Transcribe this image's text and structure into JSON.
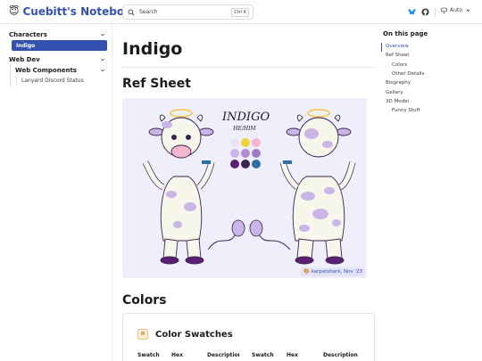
{
  "header": {
    "logo_emoji": "😇",
    "site_title": "Cuebitt's Notebook",
    "search_placeholder": "Search",
    "search_shortcut": "Ctrl K",
    "theme_label": "Auto"
  },
  "sidebar": {
    "groups": [
      {
        "label": "Characters",
        "items": [
          {
            "label": "Indigo",
            "active": true
          }
        ]
      },
      {
        "label": "Web Dev",
        "subgroups": [
          {
            "label": "Web Components",
            "items": [
              {
                "label": "Lanyard Discord Status"
              }
            ]
          }
        ]
      }
    ]
  },
  "page": {
    "title": "Indigo",
    "sections": {
      "ref_sheet": "Ref Sheet",
      "colors": "Colors"
    },
    "image": {
      "name_text": "INDIGO",
      "pronouns_text": "HE/HIM",
      "credit": "karpetshark, Nov '23",
      "palette": [
        "#e7e3f4",
        "#f4d23a",
        "#f3b6cf",
        "#c9b5e6",
        "#b48ad6",
        "#9b7cc5",
        "#5b1f73",
        "#3b2350",
        "#2f6fa6"
      ]
    },
    "swatch_card": {
      "icon": "⚙",
      "title": "Color Swatches",
      "columns": [
        "Swatch",
        "Hex",
        "Description",
        "Swatch",
        "Hex",
        "Description"
      ]
    }
  },
  "toc": {
    "title": "On this page",
    "items": [
      {
        "label": "Overview",
        "level": 0,
        "active": true
      },
      {
        "label": "Ref Sheet",
        "level": 0
      },
      {
        "label": "Colors",
        "level": 1
      },
      {
        "label": "Other Details",
        "level": 1
      },
      {
        "label": "Biography",
        "level": 0
      },
      {
        "label": "Gallery",
        "level": 0
      },
      {
        "label": "3D Model",
        "level": 0
      },
      {
        "label": "Funny Stuff",
        "level": 1
      }
    ]
  },
  "colors": {
    "brand": "#3451b2",
    "text": "#1b1b1f"
  }
}
